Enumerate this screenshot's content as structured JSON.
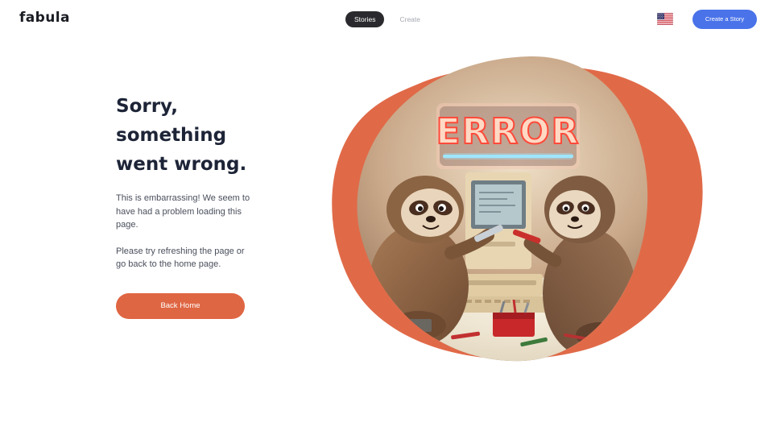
{
  "brand": {
    "logo_text": "fabula"
  },
  "nav": {
    "items": [
      {
        "label": "Stories",
        "active": true
      },
      {
        "label": "Create",
        "active": false
      }
    ]
  },
  "header": {
    "language_flag": "us-flag-icon",
    "cta_label": "Create a Story",
    "cta_color": "#4a73ea"
  },
  "error": {
    "headline": [
      "Sorry,",
      "something",
      "went wrong."
    ],
    "paragraph_1": "This is embarrassing! We seem to have had a problem loading this page.",
    "paragraph_2": "Please try refreshing the page or go back to the home page.",
    "button_label": "Back Home",
    "button_color": "#df6643"
  },
  "illustration": {
    "sign_text": "ERROR",
    "accent_color": "#e06a48"
  }
}
